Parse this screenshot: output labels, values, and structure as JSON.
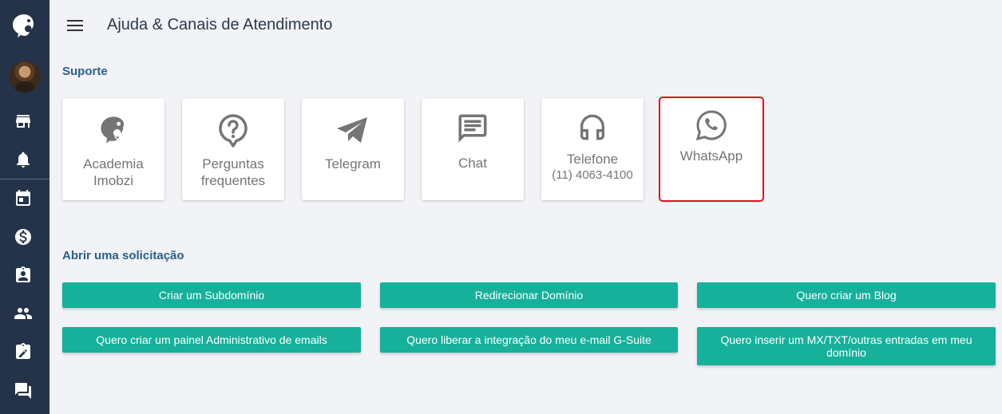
{
  "header": {
    "title": "Ajuda & Canais de Atendimento"
  },
  "sections": {
    "support": "Suporte",
    "requests": "Abrir uma solicitação"
  },
  "cards": [
    {
      "label": "Academia Imobzi",
      "icon": "chameleon-icon"
    },
    {
      "label": "Perguntas frequentes",
      "icon": "question-icon"
    },
    {
      "label": "Telegram",
      "icon": "telegram-icon"
    },
    {
      "label": "Chat",
      "icon": "chat-icon"
    },
    {
      "label": "Telefone",
      "sub": "(11) 4063-4100",
      "icon": "headset-icon"
    },
    {
      "label": "WhatsApp",
      "icon": "whatsapp-icon"
    }
  ],
  "buttons": [
    "Criar um Subdomínio",
    "Redirecionar Domínio",
    "Quero criar um Blog",
    "Quero criar um painel Administrativo de emails",
    "Quero liberar a integração do meu e-mail G-Suite",
    "Quero inserir um MX/TXT/outras entradas em meu domínio"
  ],
  "sidebar": {
    "icons": [
      "logo-icon",
      "avatar",
      "store-icon",
      "bell-icon",
      "calendar-icon",
      "dollar-icon",
      "contact-badge-icon",
      "people-icon",
      "clipboard-edit-icon",
      "forum-icon"
    ]
  },
  "colors": {
    "sidebar": "#24334a",
    "accent": "#17b09b",
    "highlight": "#e0121b",
    "section_title": "#2a5f8a"
  }
}
